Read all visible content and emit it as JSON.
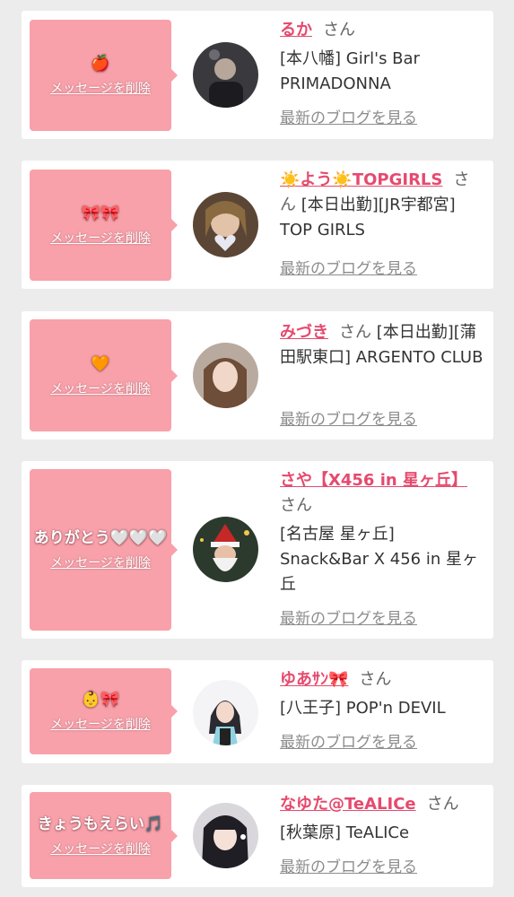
{
  "delete_label": "メッセージを削除",
  "san_label": "さん",
  "blog_label": "最新のブログを見る",
  "colors": {
    "background": "#ececec",
    "card": "#ffffff",
    "bubble": "#f8a1aa",
    "name": "#e54a6e",
    "link": "#8c8c8c"
  },
  "cards": [
    {
      "message": "🍎",
      "name": "るか",
      "shop": "[本八幡] Girl's Bar PRIMADONNA"
    },
    {
      "message": "🎀🎀",
      "name": "☀️よう☀️TOPGIRLS",
      "shop": "[本日出勤][JR宇都宮] TOP GIRLS"
    },
    {
      "message": "🧡",
      "name": "みづき",
      "shop": "[本日出勤][蒲田駅東口] ARGENTO CLUB"
    },
    {
      "message": "ありがとう🤍🤍🤍",
      "name": "さや【X456 in 星ヶ丘】",
      "shop": "[名古屋 星ヶ丘] Snack&Bar X 456 in 星ヶ丘"
    },
    {
      "message": "👶🎀",
      "name": "ゆあｻﾝ🎀",
      "shop": "[八王子] POP'n DEVIL"
    },
    {
      "message": "きょうもえらい🎵",
      "name": "なゆた@TeALICe",
      "shop": "[秋葉原] TeALICe"
    }
  ]
}
